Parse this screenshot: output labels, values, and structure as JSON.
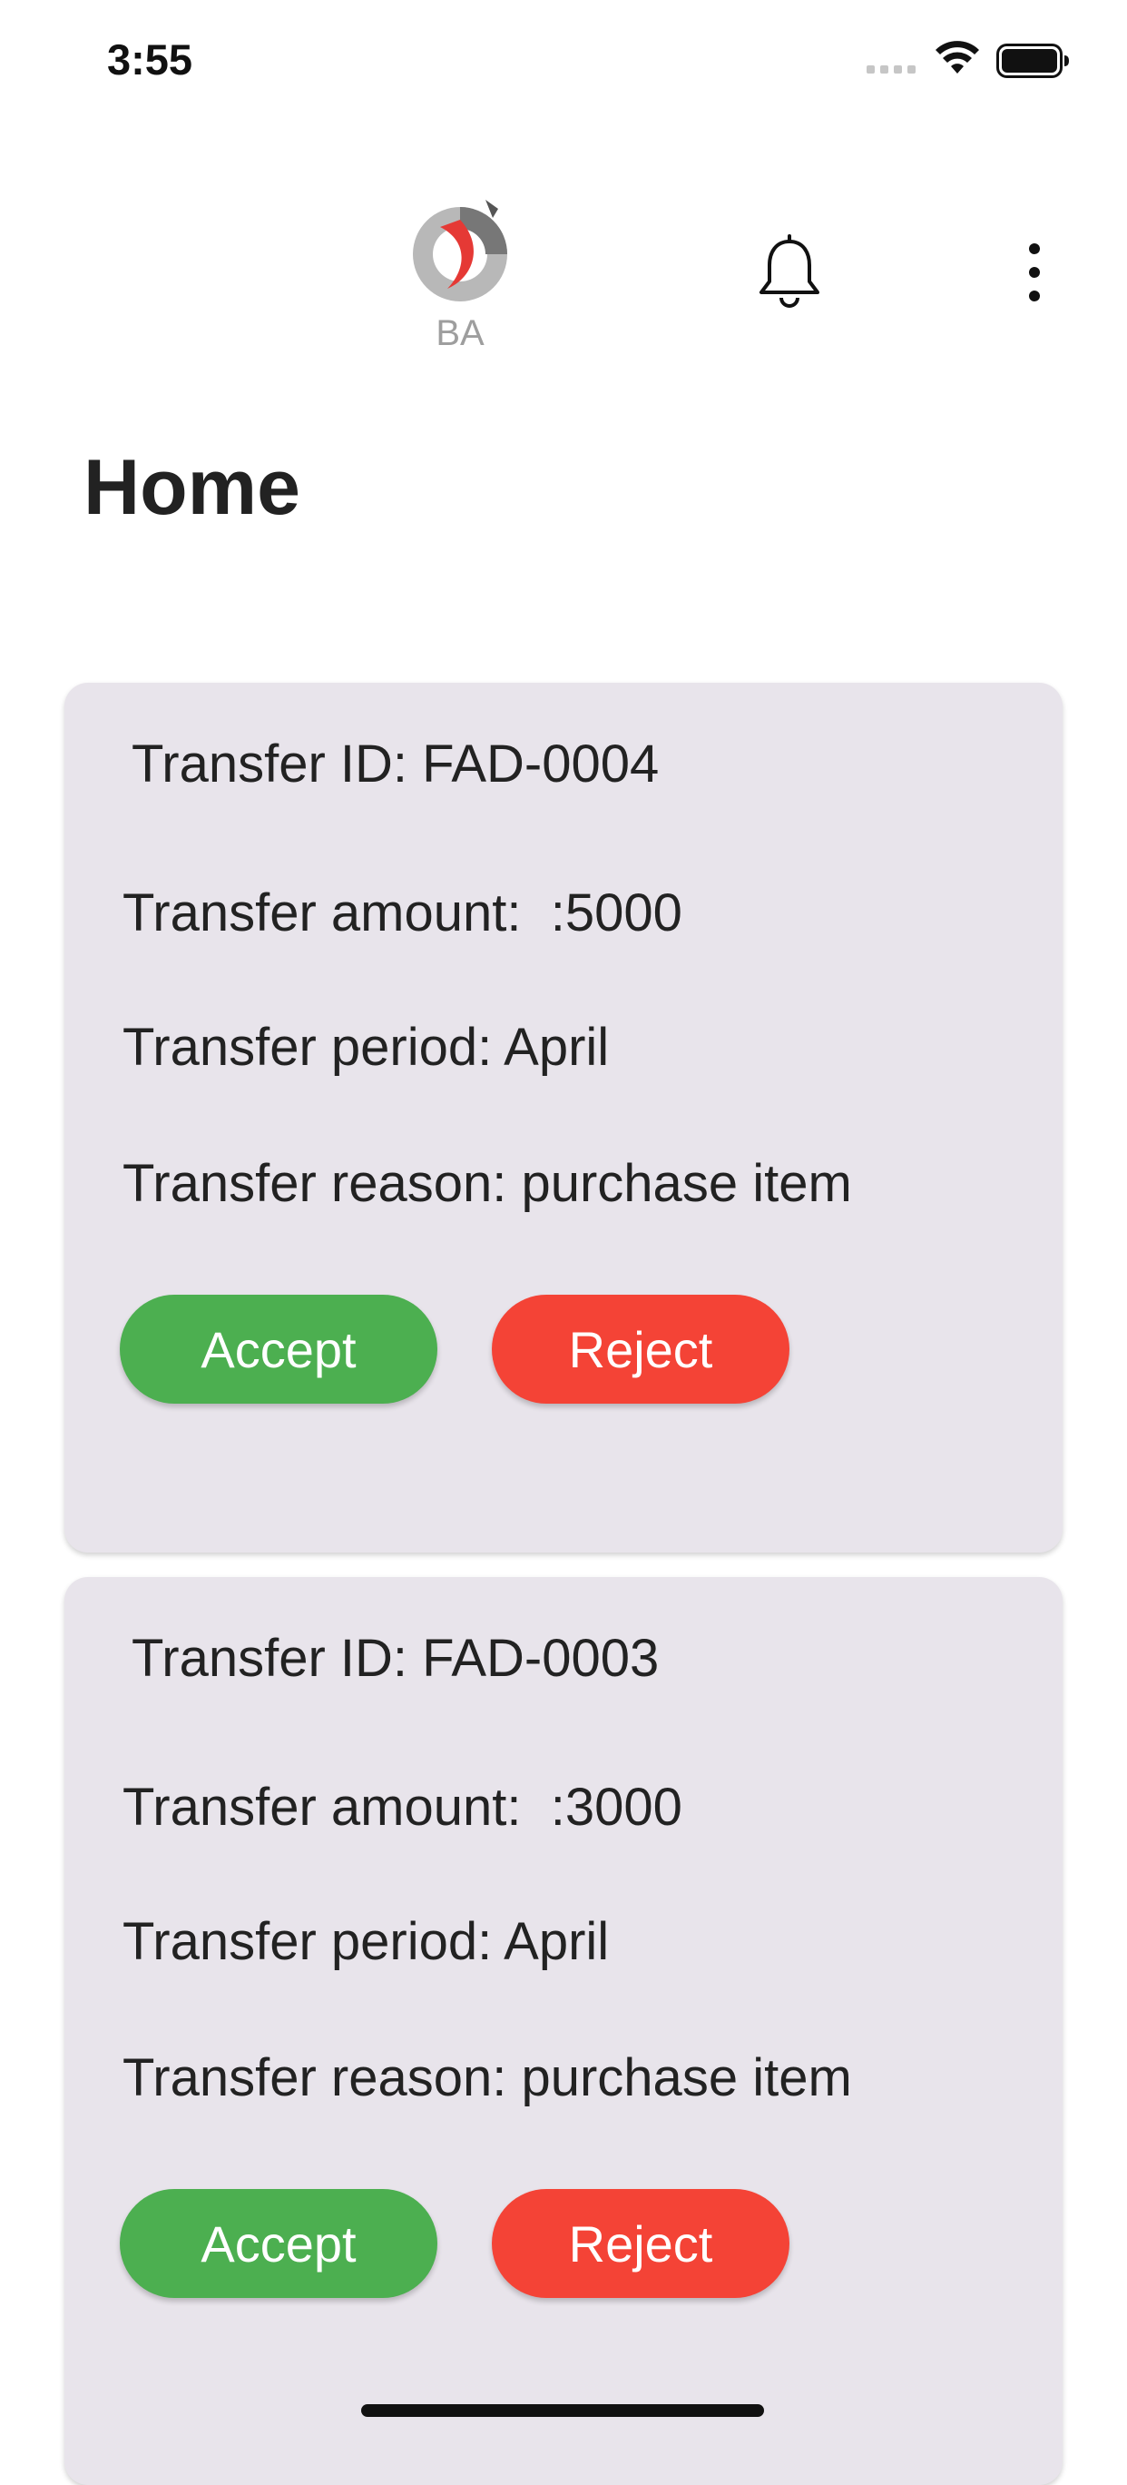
{
  "status_bar": {
    "time": "3:55"
  },
  "app_bar": {
    "logo_text": "BA"
  },
  "page": {
    "title": "Home"
  },
  "transfers": [
    {
      "id_label": "Transfer ID: FAD-0004",
      "amount_label": "Transfer amount:  :5000",
      "period_label": "Transfer period: April",
      "reason_label": "Transfer reason: purchase item",
      "accept_label": "Accept",
      "reject_label": "Reject"
    },
    {
      "id_label": "Transfer ID: FAD-0003",
      "amount_label": "Transfer amount:  :3000",
      "period_label": "Transfer period: April",
      "reason_label": "Transfer reason: purchase item",
      "accept_label": "Accept",
      "reject_label": "Reject"
    }
  ],
  "colors": {
    "accept": "#4caf50",
    "reject": "#f44336",
    "card_background": "#e8e4eb"
  },
  "icons": [
    "wifi-icon",
    "battery-icon",
    "bell-icon",
    "more-vertical-icon",
    "ba-logo"
  ]
}
